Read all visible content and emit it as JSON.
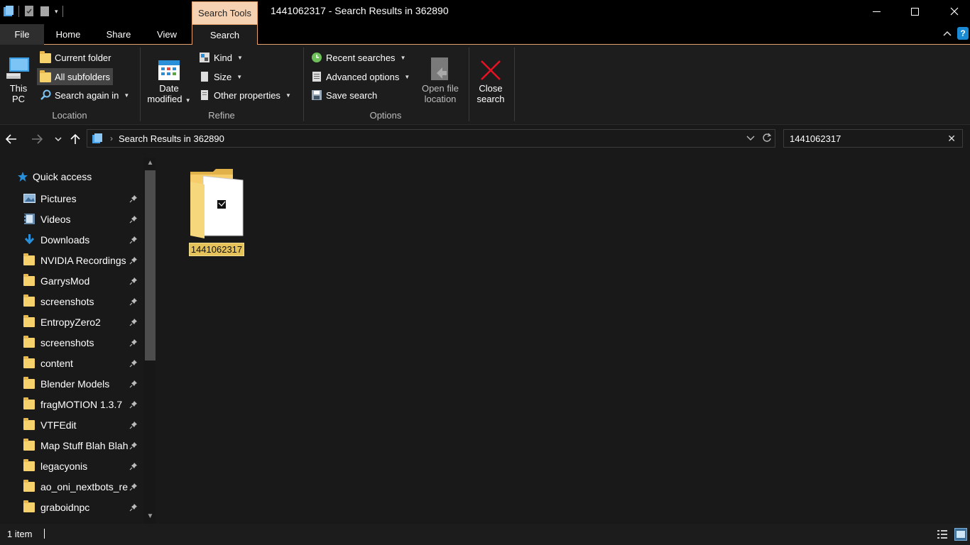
{
  "window": {
    "title": "1441062317 - Search Results in 362890",
    "context_tab": "Search Tools"
  },
  "tabs": {
    "file": "File",
    "home": "Home",
    "share": "Share",
    "view": "View",
    "search": "Search",
    "help_glyph": "?"
  },
  "ribbon": {
    "location": {
      "group_label": "Location",
      "this_pc_line1": "This",
      "this_pc_line2": "PC",
      "current_folder": "Current folder",
      "all_subfolders": "All subfolders",
      "search_again_in": "Search again in"
    },
    "refine": {
      "group_label": "Refine",
      "date_modified_line1": "Date",
      "date_modified_line2": "modified",
      "kind": "Kind",
      "size": "Size",
      "other_properties": "Other properties"
    },
    "options": {
      "group_label": "Options",
      "recent_searches": "Recent searches",
      "advanced_options": "Advanced options",
      "save_search": "Save search",
      "open_file_location_line1": "Open file",
      "open_file_location_line2": "location",
      "close_search_line1": "Close",
      "close_search_line2": "search"
    }
  },
  "address": {
    "crumb": "Search Results in 362890",
    "search_value": "1441062317"
  },
  "nav": {
    "quick_access": "Quick access",
    "items": [
      {
        "label": "Pictures",
        "icon": "pictures-icon"
      },
      {
        "label": "Videos",
        "icon": "videos-icon"
      },
      {
        "label": "Downloads",
        "icon": "downloads-icon"
      },
      {
        "label": "NVIDIA Recordings",
        "icon": "folder-icon"
      },
      {
        "label": "GarrysMod",
        "icon": "folder-icon"
      },
      {
        "label": "screenshots",
        "icon": "folder-icon"
      },
      {
        "label": "EntropyZero2",
        "icon": "folder-icon"
      },
      {
        "label": "screenshots",
        "icon": "folder-icon"
      },
      {
        "label": "content",
        "icon": "folder-icon"
      },
      {
        "label": "Blender Models",
        "icon": "folder-icon"
      },
      {
        "label": "fragMOTION 1.3.7",
        "icon": "folder-icon"
      },
      {
        "label": "VTFEdit",
        "icon": "folder-icon"
      },
      {
        "label": "Map Stuff Blah Blah",
        "icon": "folder-icon"
      },
      {
        "label": "legacyonis",
        "icon": "folder-icon"
      },
      {
        "label": "ao_oni_nextbots_re",
        "icon": "folder-icon"
      },
      {
        "label": "graboidnpc",
        "icon": "folder-icon"
      }
    ]
  },
  "content": {
    "items": [
      {
        "name": "1441062317"
      }
    ]
  },
  "status": {
    "count": "1 item"
  },
  "colors": {
    "accent_tab": "#f6d2b2",
    "selection": "#e5c35a",
    "folder": "#f7d16b",
    "close_x": "#e81123"
  }
}
